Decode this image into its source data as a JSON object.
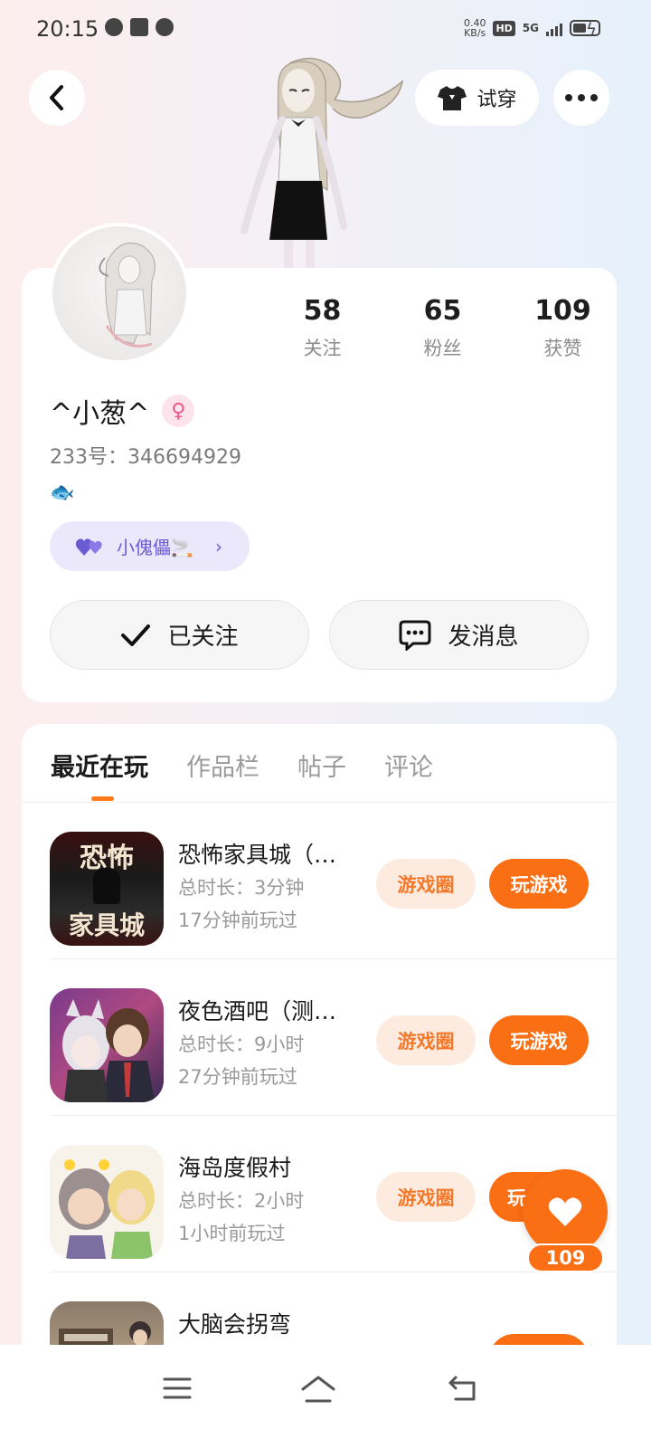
{
  "status_bar": {
    "time": "20:15",
    "net_speed_value": "0.40",
    "net_speed_unit": "KB/s",
    "hd_badge": "HD",
    "network": "5G"
  },
  "header": {
    "try_on_label": "试穿",
    "back_icon": "chevron-left-icon",
    "more_icon": "more-dots-icon",
    "tshirt_icon": "tshirt-icon"
  },
  "profile": {
    "username": "^小葱^",
    "gender_symbol": "♀",
    "uid_label": "233号：346694929",
    "signature": "🐟",
    "relation_label": "小傀儡🚬",
    "relation_arrow": "›",
    "stats": [
      {
        "value": "58",
        "label": "关注"
      },
      {
        "value": "65",
        "label": "粉丝"
      },
      {
        "value": "109",
        "label": "获赞"
      }
    ],
    "follow_label": "已关注",
    "message_label": "发消息"
  },
  "tabs": [
    {
      "label": "最近在玩",
      "active": true
    },
    {
      "label": "作品栏",
      "active": false
    },
    {
      "label": "帖子",
      "active": false
    },
    {
      "label": "评论",
      "active": false
    }
  ],
  "games": [
    {
      "title": "恐怖家具城（…",
      "icon_text_top": "恐怖",
      "icon_text_bottom": "家具城",
      "duration": "总时长：3分钟",
      "last_played": "17分钟前玩过",
      "circle_label": "游戏圈",
      "play_label": "玩游戏"
    },
    {
      "title": "夜色酒吧（测…",
      "duration": "总时长：9小时",
      "last_played": "27分钟前玩过",
      "circle_label": "游戏圈",
      "play_label": "玩游戏"
    },
    {
      "title": "海岛度假村",
      "duration": "总时长：2小时",
      "last_played": "1小时前玩过",
      "circle_label": "游戏圈",
      "play_label": "玩"
    },
    {
      "title": "大脑会拐弯",
      "duration": "",
      "last_played": "",
      "circle_label": "",
      "play_label": ""
    }
  ],
  "like_fab": {
    "count": "109"
  },
  "colors": {
    "accent": "#fa6e14",
    "accent_light": "#fdebdf",
    "relation_bg": "#ece8fc",
    "relation_text": "#6b5bd4"
  }
}
